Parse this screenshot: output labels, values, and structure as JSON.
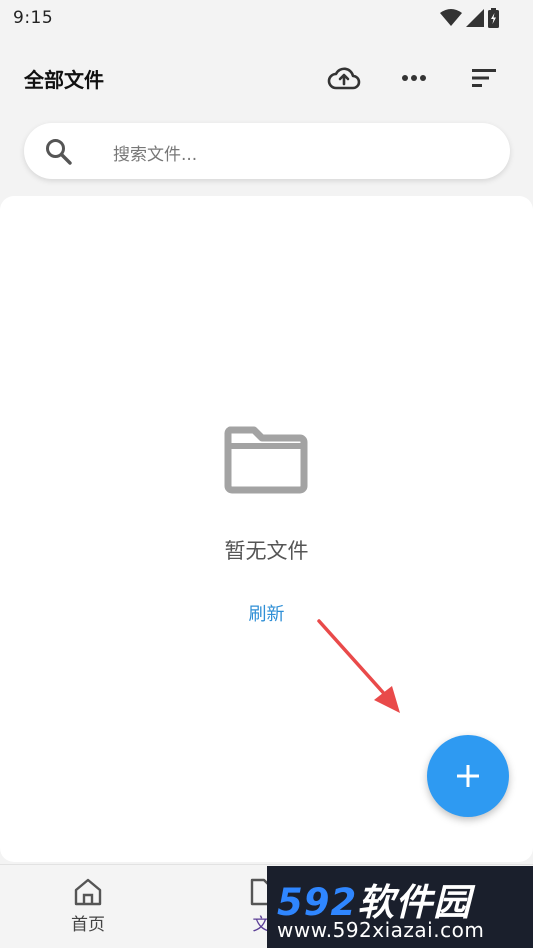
{
  "status_bar": {
    "time": "9:15",
    "icons": [
      "wifi-icon",
      "signal-icon",
      "battery-icon"
    ]
  },
  "app_bar": {
    "title": "全部文件",
    "actions": [
      "cloud-upload-icon",
      "more-icon",
      "sort-icon"
    ]
  },
  "search": {
    "placeholder": "搜索文件..."
  },
  "empty_state": {
    "icon": "folder-icon",
    "message": "暂无文件",
    "refresh_label": "刷新"
  },
  "fab": {
    "icon": "add-icon",
    "color": "#2e9af2"
  },
  "annotation": {
    "icon": "arrow-icon",
    "color": "#e94a4a"
  },
  "bottom_nav": {
    "items": [
      {
        "label": "首页",
        "icon": "home-icon",
        "active": false
      },
      {
        "label": "文",
        "icon": "document-icon",
        "active": true
      }
    ]
  },
  "watermark": {
    "number": "592",
    "text": "软件园",
    "url": "www.592xiazai.com"
  },
  "colors": {
    "accent": "#2e9af2",
    "link": "#2f8fd6",
    "active_nav": "#5b3e96"
  }
}
